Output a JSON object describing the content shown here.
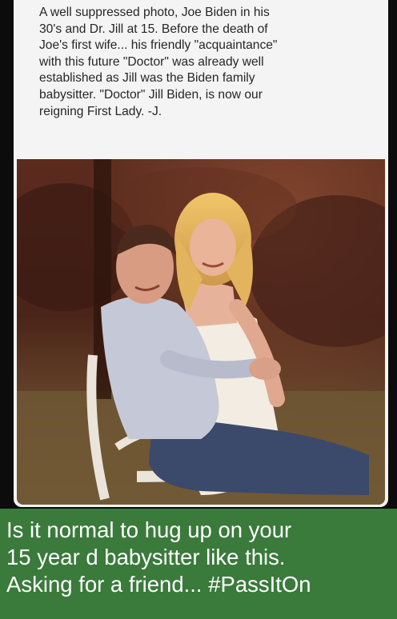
{
  "post": {
    "text": "A well suppressed photo, Joe Biden in his\n30's and Dr. Jill at 15. Before the death of\nJoe's first wife... his friendly \"acquaintance\"\nwith this future \"Doctor\" was already well\nestablished as Jill was the Biden family\nbabysitter. \"Doctor\" Jill Biden, is now our\nreigning First Lady. -J."
  },
  "photo": {
    "subject": "vintage sepia photo of a man and a young blonde woman seated on a white lawn chair outdoors"
  },
  "caption": {
    "text": "Is it normal to hug up on your\n15 year d babysitter like this.\nAsking for a friend... #PassItOn"
  },
  "colors": {
    "page_background": "#0c0c0c",
    "card_background": "#f4f4f4",
    "caption_background": "#3a7a3b",
    "caption_text": "#ffffff"
  }
}
